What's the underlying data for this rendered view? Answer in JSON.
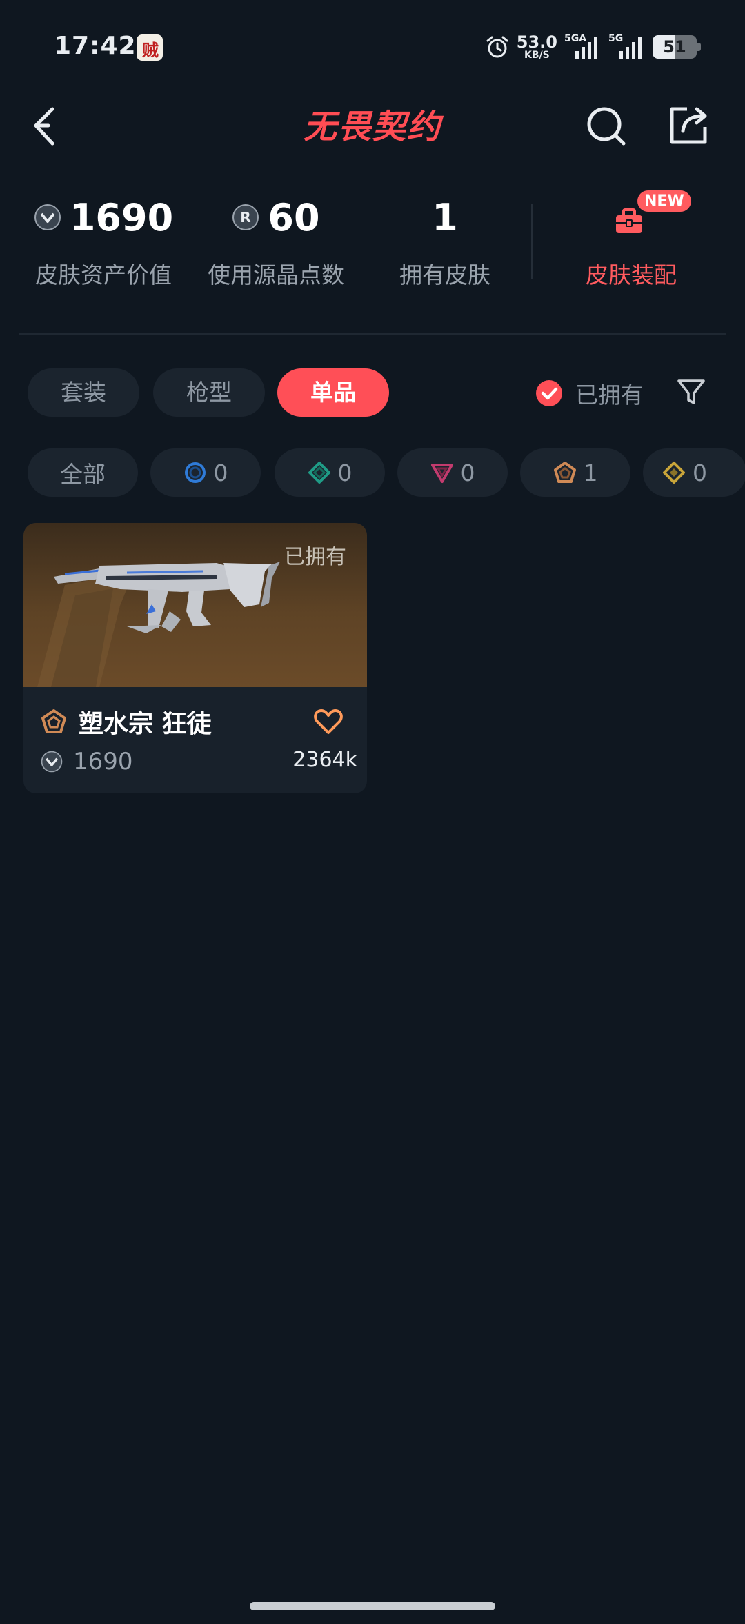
{
  "status_bar": {
    "time": "17:42",
    "net_speed": "53.0",
    "net_speed_unit": "KB/S",
    "sim1_tag": "5GA",
    "sim2_tag": "5G",
    "battery": "51"
  },
  "header": {
    "title": "无畏契约",
    "accent_color": "#ff4d54"
  },
  "stats": [
    {
      "value": "1690",
      "label": "皮肤资产价值",
      "icon": "vp-coin-icon"
    },
    {
      "value": "60",
      "label": "使用源晶点数",
      "icon": "radianite-icon"
    },
    {
      "value": "1",
      "label": "拥有皮肤"
    }
  ],
  "equip": {
    "label": "皮肤装配",
    "badge": "NEW"
  },
  "tabs": [
    {
      "label": "套装",
      "active": false
    },
    {
      "label": "枪型",
      "active": false
    },
    {
      "label": "单品",
      "active": true
    }
  ],
  "owned_filter": {
    "label": "已拥有",
    "checked": true
  },
  "rarity_chips": [
    {
      "label": "全部"
    },
    {
      "count": "0",
      "icon": "select-tier-icon",
      "color": "#2f7bd8"
    },
    {
      "count": "0",
      "icon": "deluxe-tier-icon",
      "color": "#1f9b86"
    },
    {
      "count": "0",
      "icon": "premium-tier-icon",
      "color": "#c23b6e"
    },
    {
      "count": "1",
      "icon": "exclusive-tier-icon",
      "color": "#d08a56"
    },
    {
      "count": "0",
      "icon": "ultra-tier-icon",
      "color": "#c9a53a"
    }
  ],
  "skins": [
    {
      "owned_tag": "已拥有",
      "name": "塑水宗 狂徒",
      "price": "1690",
      "likes": "2364k"
    }
  ]
}
